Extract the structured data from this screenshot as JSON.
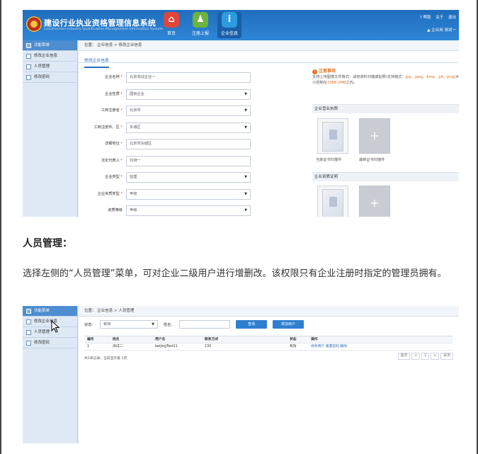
{
  "screenshot1": {
    "header": {
      "title": "建设行业执业资格管理信息系统",
      "subtitle": "Construction Industry Qualification Management Information System",
      "nav": [
        {
          "label": "首页",
          "icon": "home-icon",
          "glyph": "⌂",
          "color": "#e0453a"
        },
        {
          "label": "注册上报",
          "icon": "user-icon",
          "glyph": "♟",
          "color": "#6cb33f"
        },
        {
          "label": "企业信息",
          "icon": "info-icon",
          "glyph": "i",
          "color": "#2d9be0"
        }
      ],
      "top_links": [
        "? 帮助",
        "关于",
        "退出"
      ],
      "user_text": "▲ 企业用 测试一"
    },
    "sidebar": {
      "items": [
        "功能菜单",
        "修改企业信息",
        "人员管理",
        "修改密码"
      ]
    },
    "breadcrumb": "位置：  企业信息  >  修改企业信息",
    "tab": "修改企业信息",
    "form": [
      {
        "label": "企业名称",
        "required": true,
        "value": "北京测试企业一",
        "select": false
      },
      {
        "label": "企业性质",
        "required": true,
        "value": "国有企业",
        "select": true
      },
      {
        "label": "工商注册省",
        "required": true,
        "value": "北京市",
        "select": true
      },
      {
        "label": "工商注册市、区",
        "required": true,
        "value": "东城区",
        "select": true
      },
      {
        "label": "详细地址",
        "required": true,
        "value": "北京市东城区",
        "select": false
      },
      {
        "label": "法定代表人",
        "required": true,
        "value": "刘测一",
        "select": false
      },
      {
        "label": "企业类型",
        "required": true,
        "value": "监理",
        "select": true
      },
      {
        "label": "企业资质类型",
        "required": true,
        "value": "甲级",
        "select": true
      },
      {
        "label": "资质等级",
        "required": false,
        "value": "甲级",
        "select": true
      }
    ],
    "notice": {
      "title": "注意事项",
      "line1_a": "支持上传图像文件格式：请将资料扫描或拍照(支持格式：",
      "formats": "jpg、jpeg、bmp、gif、png",
      "line2_a": ")大小控制在",
      "size": "10KB-2MB",
      "line2_b": "之内。"
    },
    "section_license": "企业营业执照",
    "caption_scanned": "当前证书扫描件",
    "caption_new": "最新证书扫描件",
    "section_cert": "企业资质证明"
  },
  "heading": "人员管理：",
  "paragraph": "选择左侧的“人员管理”菜单，可对企业二级用户进行增删改。该权限只有企业注册时指定的管理员拥有。",
  "screenshot2": {
    "sidebar": {
      "items": [
        "功能菜单",
        "修改企业信息",
        "人员管理",
        "修改密码"
      ]
    },
    "breadcrumb": "位置：  企业信息  >  人员管理",
    "filter": {
      "state_label": "状态：",
      "state_value": "有效",
      "name_label": "姓名：",
      "search_button": "查询",
      "add_button": "增加用户"
    },
    "table": {
      "headers": [
        "编号",
        "姓名",
        "用户名",
        "联系方式",
        "状态",
        "操作"
      ],
      "rows": [
        {
          "id": "1",
          "name": "测试二",
          "username": "beijingTest11",
          "contact": "130",
          "status": "有效",
          "actions": "修改用户  重置密码   删除"
        }
      ]
    },
    "summary": "共1条记录，当前显示第 1页",
    "pager": [
      "首页",
      "<",
      "1",
      ">",
      "末页"
    ]
  }
}
